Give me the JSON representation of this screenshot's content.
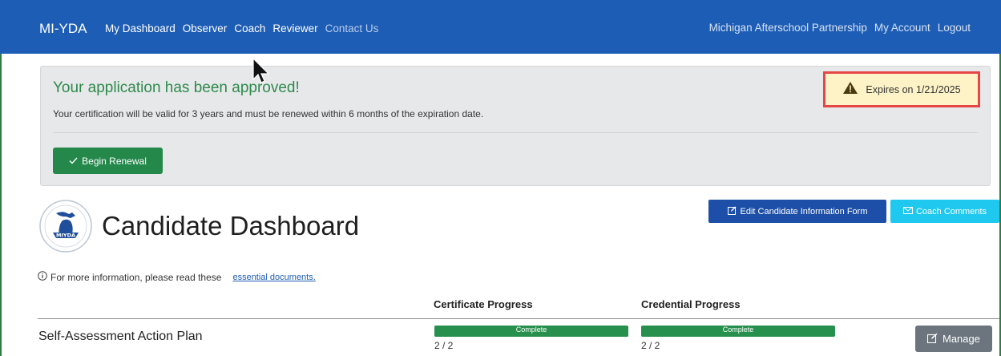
{
  "navbar": {
    "brand": "MI-YDA",
    "left_links": [
      "My Dashboard",
      "Observer",
      "Coach",
      "Reviewer",
      "Contact Us"
    ],
    "right_links": [
      "Michigan Afterschool Partnership",
      "My Account",
      "Logout"
    ],
    "colors": {
      "bg": "#1e5db5"
    }
  },
  "alert": {
    "title": "Your application has been approved!",
    "subtitle": "Your certification will be valid for 3 years and must be renewed within 6 months of the expiration date.",
    "renew_label": "Begin Renewal",
    "expires_label": "Expires on 1/21/2025",
    "expires_icon": "warning-icon"
  },
  "dashboard": {
    "title": "Candidate Dashboard",
    "logo_text": "MIYDA",
    "edit_button": "Edit Candidate Information Form",
    "coach_button": "Coach Comments",
    "info_text": "For more information, please read these",
    "info_link": "essential documents."
  },
  "table": {
    "headers": {
      "certificate": "Certificate Progress",
      "credential": "Credential Progress"
    },
    "rows": [
      {
        "label": "Self-Assessment Action Plan",
        "certificate": {
          "status": "Complete",
          "fraction": "2 / 2",
          "progress": 1.0
        },
        "credential": {
          "status": "Complete",
          "fraction": "2 / 2",
          "progress": 1.0
        },
        "action": "Manage"
      }
    ]
  }
}
